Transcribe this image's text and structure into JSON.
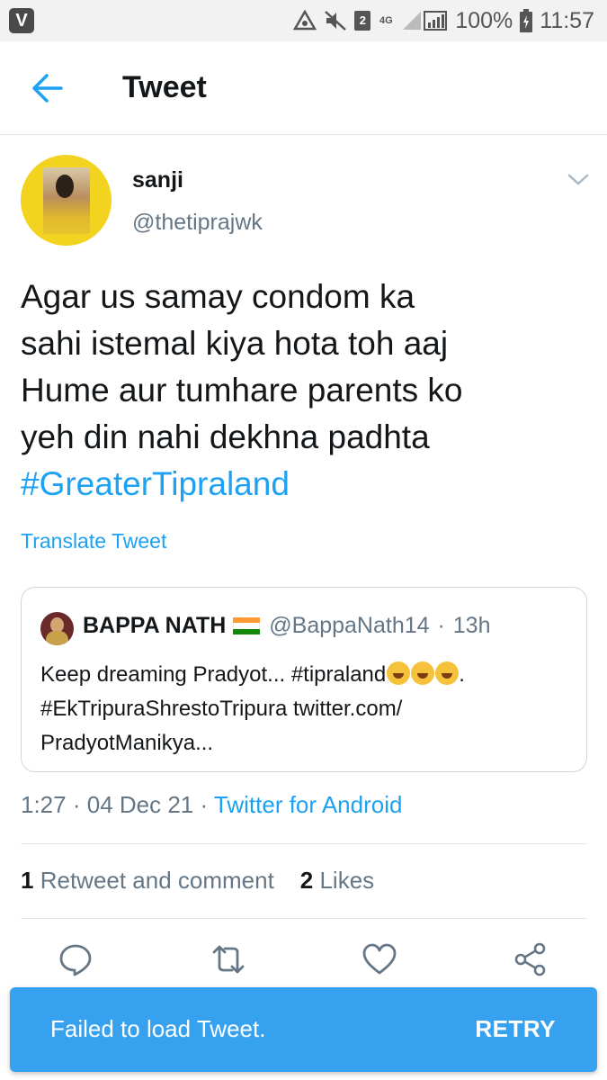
{
  "status_bar": {
    "sim_slot": "2",
    "network_type": "4G",
    "battery_level": "100%",
    "time": "11:57"
  },
  "header": {
    "title": "Tweet"
  },
  "tweet": {
    "author_name": "sanji",
    "author_handle": "@thetiprajwk",
    "text_lines": [
      "Agar us samay condom ka",
      "sahi istemal kiya hota toh aaj",
      "Hume aur tumhare parents ko",
      "yeh din nahi dekhna padhta"
    ],
    "hashtag": "#GreaterTipraland",
    "translate_label": "Translate Tweet",
    "time": "1:27",
    "date": "04 Dec 21",
    "source": "Twitter for Android",
    "retweet_count": "1",
    "retweet_label": "Retweet and comment",
    "like_count": "2",
    "like_label": "Likes"
  },
  "quoted_tweet": {
    "author_name": "BAPPA NATH",
    "author_handle": "@BappaNath14",
    "age": "13h",
    "line1": "Keep dreaming Pradyot... #tipraland",
    "line1_end": ".",
    "line2": "#EkTripuraShrestoTripura twitter.com/",
    "line3": "PradyotManikya..."
  },
  "toast": {
    "message": "Failed to load Tweet.",
    "action_label": "RETRY"
  },
  "colors": {
    "accent": "#1da1f2",
    "secondary_text": "#657786",
    "toast_bg": "#36a2ef"
  },
  "icons": {
    "back": "arrow-left-icon",
    "menu": "chevron-down-icon",
    "reply": "reply-icon",
    "retweet": "retweet-icon",
    "like": "heart-icon",
    "share": "share-icon"
  }
}
